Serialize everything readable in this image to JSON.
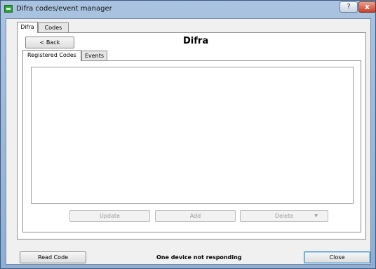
{
  "window": {
    "title": "Difra codes/event manager",
    "help_glyph": "?",
    "close_glyph": "x"
  },
  "outer_tabs": [
    {
      "label": "Difra",
      "active": true
    },
    {
      "label": "Codes",
      "active": false
    }
  ],
  "header": {
    "back_label": "< Back",
    "title": "Difra"
  },
  "inner_tabs": [
    {
      "label": "Registered Codes",
      "active": true
    },
    {
      "label": "Events",
      "active": false
    }
  ],
  "codes_list": {
    "items": []
  },
  "actions": {
    "update_label": "Update",
    "add_label": "Add",
    "delete_label": "Delete",
    "delete_arrow": "▼"
  },
  "footer": {
    "read_code_label": "Read Code",
    "status": "One device not responding",
    "close_label": "Close"
  },
  "colors": {
    "titlebar": "#a9c3e0",
    "client_bg": "#f0f0f0",
    "close_button": "#c7402b",
    "focus_border": "#3c7fb1"
  }
}
